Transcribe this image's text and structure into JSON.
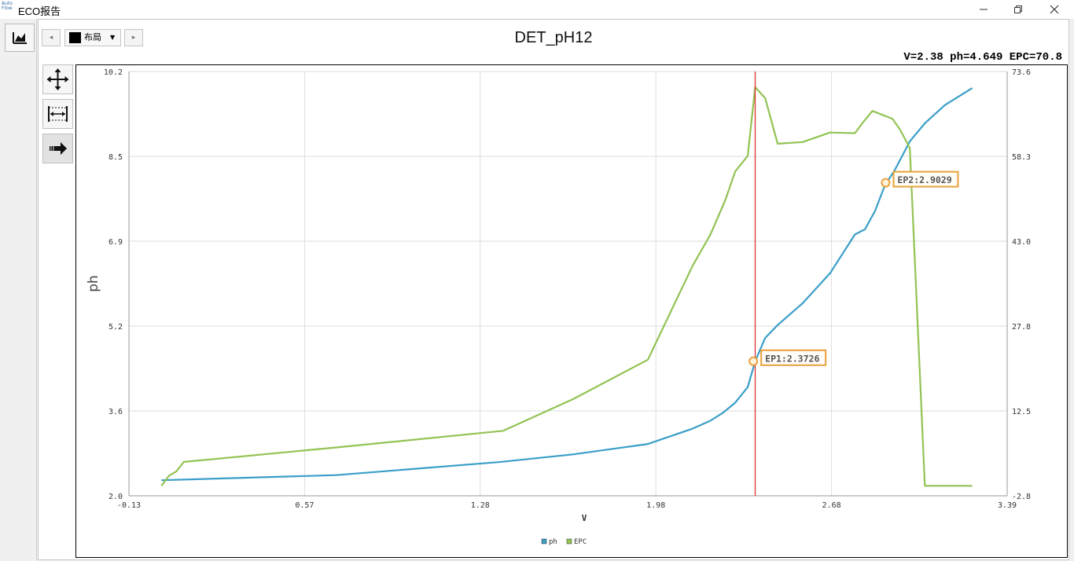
{
  "window": {
    "title": "ECO报告",
    "app_icon_text": "Auto Flow"
  },
  "toolbar": {
    "layout_label": "布局",
    "prev": "◂",
    "next": "▸"
  },
  "readout": "V=2.38  ph=4.649  EPC=70.8",
  "colors": {
    "ph": "#3a9ec8",
    "epc": "#92c353",
    "cursor": "#e03030",
    "marker": "#e8a13a"
  },
  "chart_data": {
    "type": "line",
    "title": "DET_pH12",
    "xlabel": "V",
    "ylabel": "ph",
    "xlim": [
      -0.13,
      3.39
    ],
    "ylim": [
      2.0,
      10.2
    ],
    "y2lim": [
      -2.8,
      73.6
    ],
    "x_ticks": [
      "-0.13",
      "0.57",
      "1.28",
      "1.98",
      "2.68",
      "3.39"
    ],
    "y_ticks": [
      "2.0",
      "3.6",
      "5.2",
      "6.9",
      "8.5",
      "10.2"
    ],
    "y2_ticks": [
      "-2.8",
      "12.5",
      "27.8",
      "43.0",
      "58.3",
      "73.6"
    ],
    "grid": true,
    "legend_position": "bottom",
    "cursor_x": 2.38,
    "series": [
      {
        "name": "ph",
        "axis": "left",
        "x": [
          0.0,
          0.7,
          1.35,
          1.65,
          1.95,
          2.13,
          2.2,
          2.25,
          2.3,
          2.35,
          2.38,
          2.42,
          2.47,
          2.57,
          2.68,
          2.78,
          2.82,
          2.86,
          2.9,
          2.94,
          3.0,
          3.06,
          3.14,
          3.25
        ],
        "y": [
          2.3,
          2.4,
          2.65,
          2.8,
          3.0,
          3.3,
          3.45,
          3.6,
          3.8,
          4.1,
          4.6,
          5.05,
          5.3,
          5.72,
          6.3,
          7.05,
          7.15,
          7.5,
          8.0,
          8.3,
          8.85,
          9.2,
          9.55,
          9.88
        ]
      },
      {
        "name": "EPC",
        "axis": "right",
        "x": [
          0.0,
          0.03,
          0.06,
          0.09,
          0.7,
          1.37,
          1.65,
          1.95,
          2.13,
          2.2,
          2.26,
          2.3,
          2.35,
          2.38,
          2.42,
          2.47,
          2.57,
          2.68,
          2.78,
          2.81,
          2.85,
          2.93,
          2.96,
          3.0,
          3.06,
          3.14,
          3.25
        ],
        "y": [
          -1.0,
          0.8,
          1.6,
          3.3,
          5.9,
          8.9,
          14.6,
          21.7,
          38.7,
          44.2,
          50.4,
          55.6,
          58.4,
          70.8,
          68.8,
          60.6,
          60.9,
          62.6,
          62.5,
          64.3,
          66.5,
          65.1,
          63.2,
          59.8,
          -1.0,
          -1.0,
          -1.0
        ]
      }
    ],
    "endpoints": [
      {
        "label": "EP1:2.3726",
        "x": 2.3726,
        "y": 4.6
      },
      {
        "label": "EP2:2.9029",
        "x": 2.9029,
        "y": 8.05
      }
    ]
  }
}
